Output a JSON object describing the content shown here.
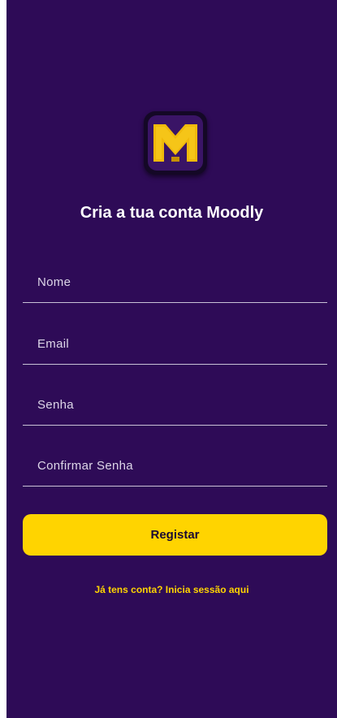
{
  "app": {
    "logo_icon": "moodly-m-logo-icon",
    "logo_letter": "M",
    "title": "Cria a tua conta Moodly"
  },
  "form": {
    "name_placeholder": "Nome",
    "email_placeholder": "Email",
    "password_placeholder": "Senha",
    "confirm_password_placeholder": "Confirmar Senha",
    "register_label": "Registar"
  },
  "footer": {
    "login_link": "Já tens conta? Inicia sessão aqui"
  },
  "colors": {
    "background": "#2e0b57",
    "accent": "#ffd400",
    "text": "#ffffff",
    "field_underline": "#c9c2d6"
  }
}
